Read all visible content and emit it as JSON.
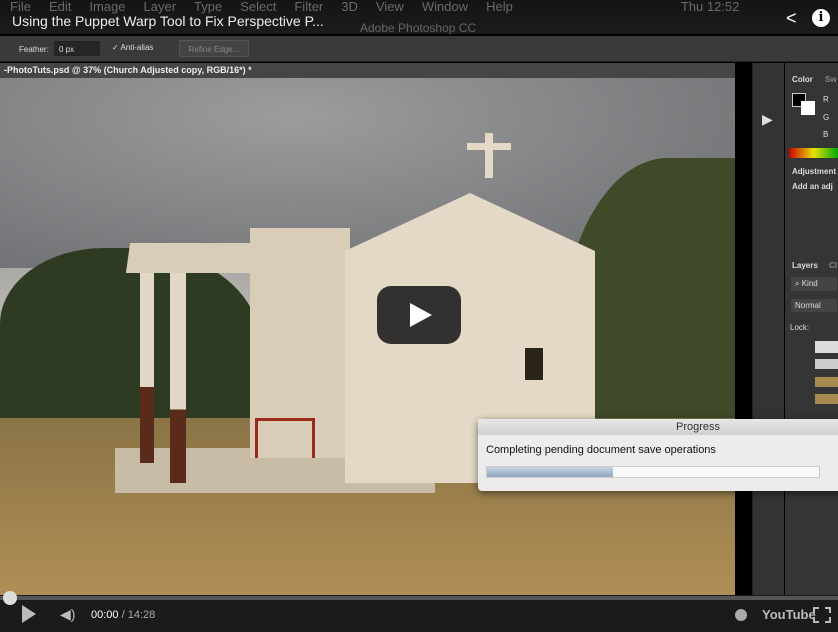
{
  "video": {
    "title": "Using the Puppet Warp Tool to Fix Perspective P...",
    "current_time": "00:00",
    "duration": "14:28",
    "progress": 0.0,
    "logo": "YouTube"
  },
  "photoshop": {
    "menu": [
      "File",
      "Edit",
      "Image",
      "Layer",
      "Type",
      "Select",
      "Filter",
      "3D",
      "View",
      "Window",
      "Help"
    ],
    "clock": "Thu 12:52",
    "app_name": "Adobe Photoshop CC",
    "options": {
      "feather_label": "Feather:",
      "feather_value": "0 px",
      "antialias_label": "Anti-alias",
      "refine_label": "Refine Edge..."
    },
    "doc_tab": "-PhotoTuts.psd @ 37% (Church Adjusted copy, RGB/16*) *",
    "panels": {
      "color_tab": "Color",
      "swatches_tab": "Sw",
      "r": "R",
      "g": "G",
      "b": "B",
      "adjustments": "Adjustment",
      "add_adj": "Add an adj",
      "layers_tab": "Layers",
      "channels_tab": "Cl",
      "kind": "Kind",
      "blend": "Normal",
      "lock": "Lock:"
    },
    "dialog": {
      "title": "Progress",
      "message": "Completing pending document save operations",
      "progress_percent": 38
    }
  },
  "colors": {
    "accent": "#ffffff",
    "panel": "#353535"
  }
}
